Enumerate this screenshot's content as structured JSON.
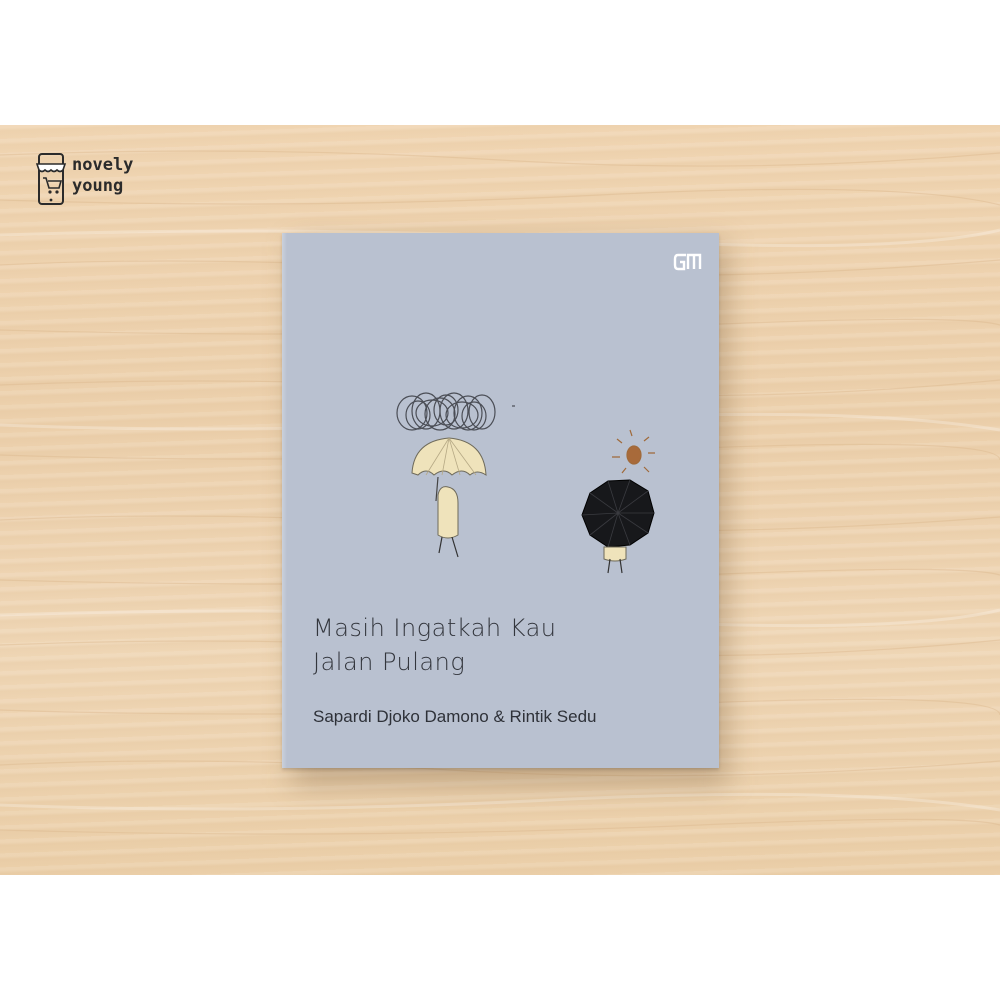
{
  "store": {
    "name_line1": "novely",
    "name_line2": "young"
  },
  "book": {
    "cover_color": "#b9c1d0",
    "publisher_logo": "GM",
    "title_line1": "Masih Ingatkah Kau",
    "title_line2": "Jalan Pulang",
    "authors": "Sapardi Djoko Damono & Rintik Sedu"
  },
  "background": {
    "color": "#eed3af"
  }
}
